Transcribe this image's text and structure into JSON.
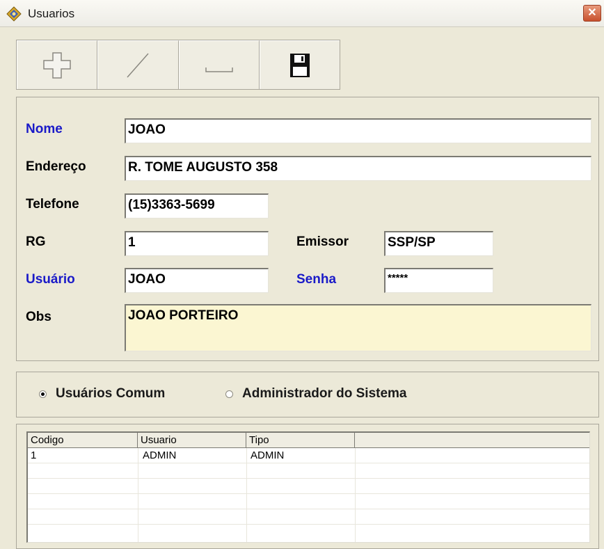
{
  "window": {
    "title": "Usuarios",
    "close_glyph": "✕"
  },
  "toolbar": {
    "buttons": [
      {
        "name": "add-button",
        "icon": "plus-icon"
      },
      {
        "name": "edit-button",
        "icon": "pencil-icon"
      },
      {
        "name": "delete-button",
        "icon": "minus-icon"
      },
      {
        "name": "save-button",
        "icon": "floppy-disk-icon"
      }
    ]
  },
  "form": {
    "nome": {
      "label": "Nome",
      "value": "JOAO"
    },
    "endereco": {
      "label": "Endereço",
      "value": "R. TOME AUGUSTO 358"
    },
    "telefone": {
      "label": "Telefone",
      "value": "(15)3363-5699"
    },
    "rg": {
      "label": "RG",
      "value": "1"
    },
    "emissor": {
      "label": "Emissor",
      "value": "SSP/SP"
    },
    "usuario": {
      "label": "Usuário",
      "value": "JOAO"
    },
    "senha": {
      "label": "Senha",
      "value": "*****"
    },
    "obs": {
      "label": "Obs",
      "value": "JOAO PORTEIRO"
    }
  },
  "user_type": {
    "options": [
      "Usuários Comum",
      "Administrador do Sistema"
    ],
    "selected": "Usuários Comum"
  },
  "grid": {
    "columns": [
      "Codigo",
      "Usuario",
      "Tipo"
    ],
    "rows": [
      [
        "1",
        "ADMIN",
        "ADMIN"
      ]
    ]
  },
  "colors": {
    "required_label": "#1a1ac8",
    "obs_background": "#fbf6d2",
    "window_background": "#ece9d8"
  }
}
